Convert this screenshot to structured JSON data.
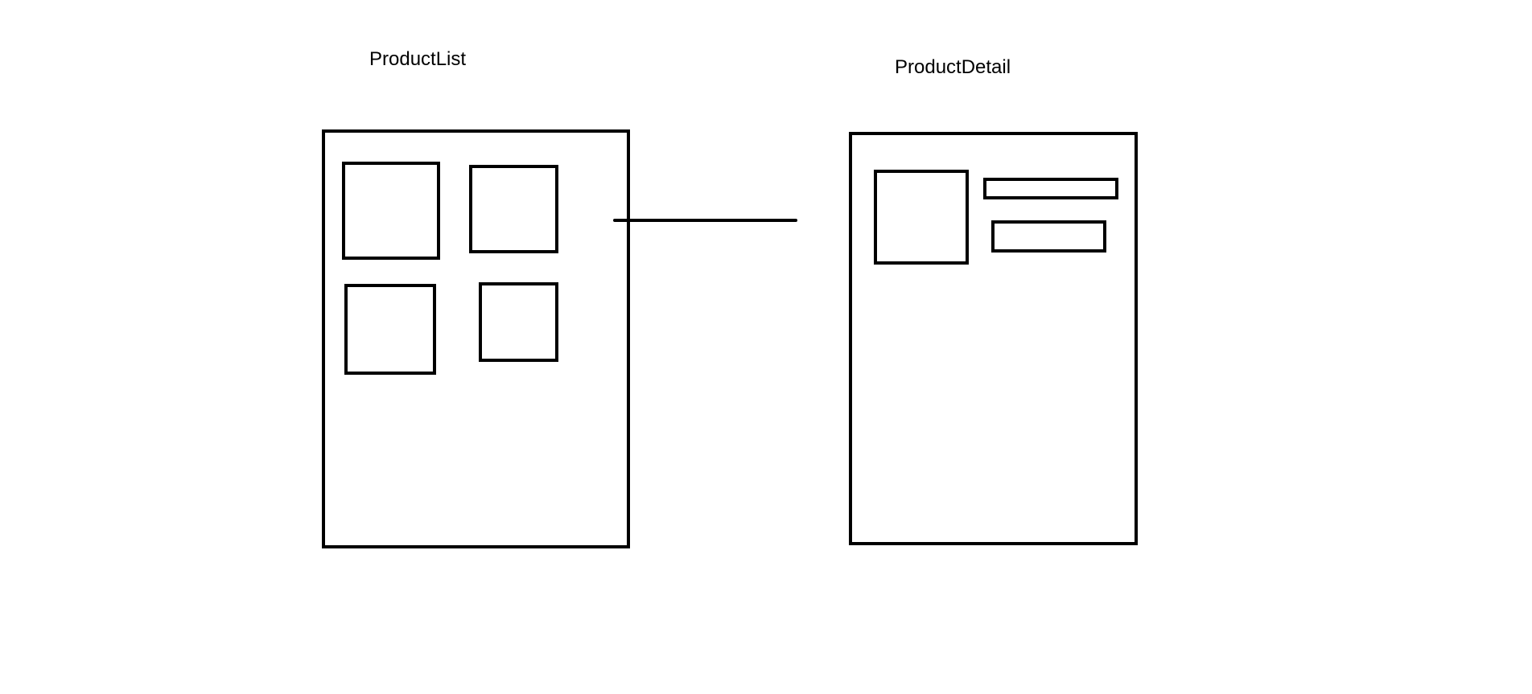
{
  "diagram": {
    "screens": [
      {
        "id": "product-list",
        "title": "ProductList"
      },
      {
        "id": "product-detail",
        "title": "ProductDetail"
      }
    ],
    "connections": [
      {
        "from": "product-list",
        "to": "product-detail",
        "style": "line"
      }
    ],
    "stroke_color": "#000000",
    "background_color": "#ffffff"
  }
}
